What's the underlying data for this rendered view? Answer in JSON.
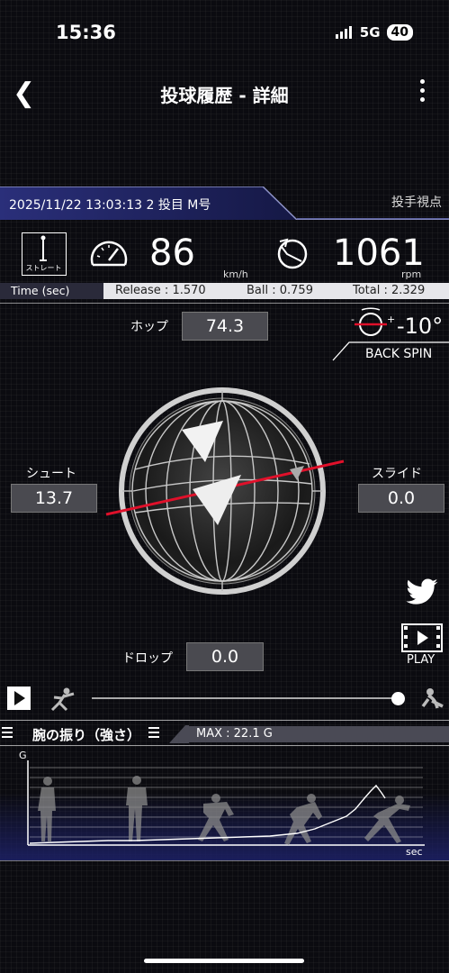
{
  "status": {
    "time": "15:36",
    "network": "5G",
    "battery": "40"
  },
  "nav": {
    "title": "投球履歴 - 詳細"
  },
  "header": {
    "info": "2025/11/22 13:03:13 2 投目 M号",
    "view": "投手視点"
  },
  "pitch": {
    "type_label": "ストレート",
    "speed": "86",
    "speed_unit": "km/h",
    "spin": "1061",
    "spin_unit": "rpm"
  },
  "timing": {
    "label": "Time (sec)",
    "release": "Release : 1.570",
    "ball": "Ball : 0.759",
    "total": "Total : 2.329"
  },
  "breaks": {
    "hop_label": "ホップ",
    "hop": "74.3",
    "shoot_label": "シュート",
    "shoot": "13.7",
    "slide_label": "スライド",
    "slide": "0.0",
    "drop_label": "ドロップ",
    "drop": "0.0"
  },
  "spin_axis": {
    "angle": "-10°",
    "type": "BACK SPIN"
  },
  "actions": {
    "play": "PLAY"
  },
  "arm_graph": {
    "title": "腕の振り（強さ）",
    "max": "MAX : 22.1 G",
    "y_label": "G",
    "x_label": "sec"
  },
  "colors": {
    "accent_red": "#e0102a",
    "header_band": "#1f2366"
  }
}
